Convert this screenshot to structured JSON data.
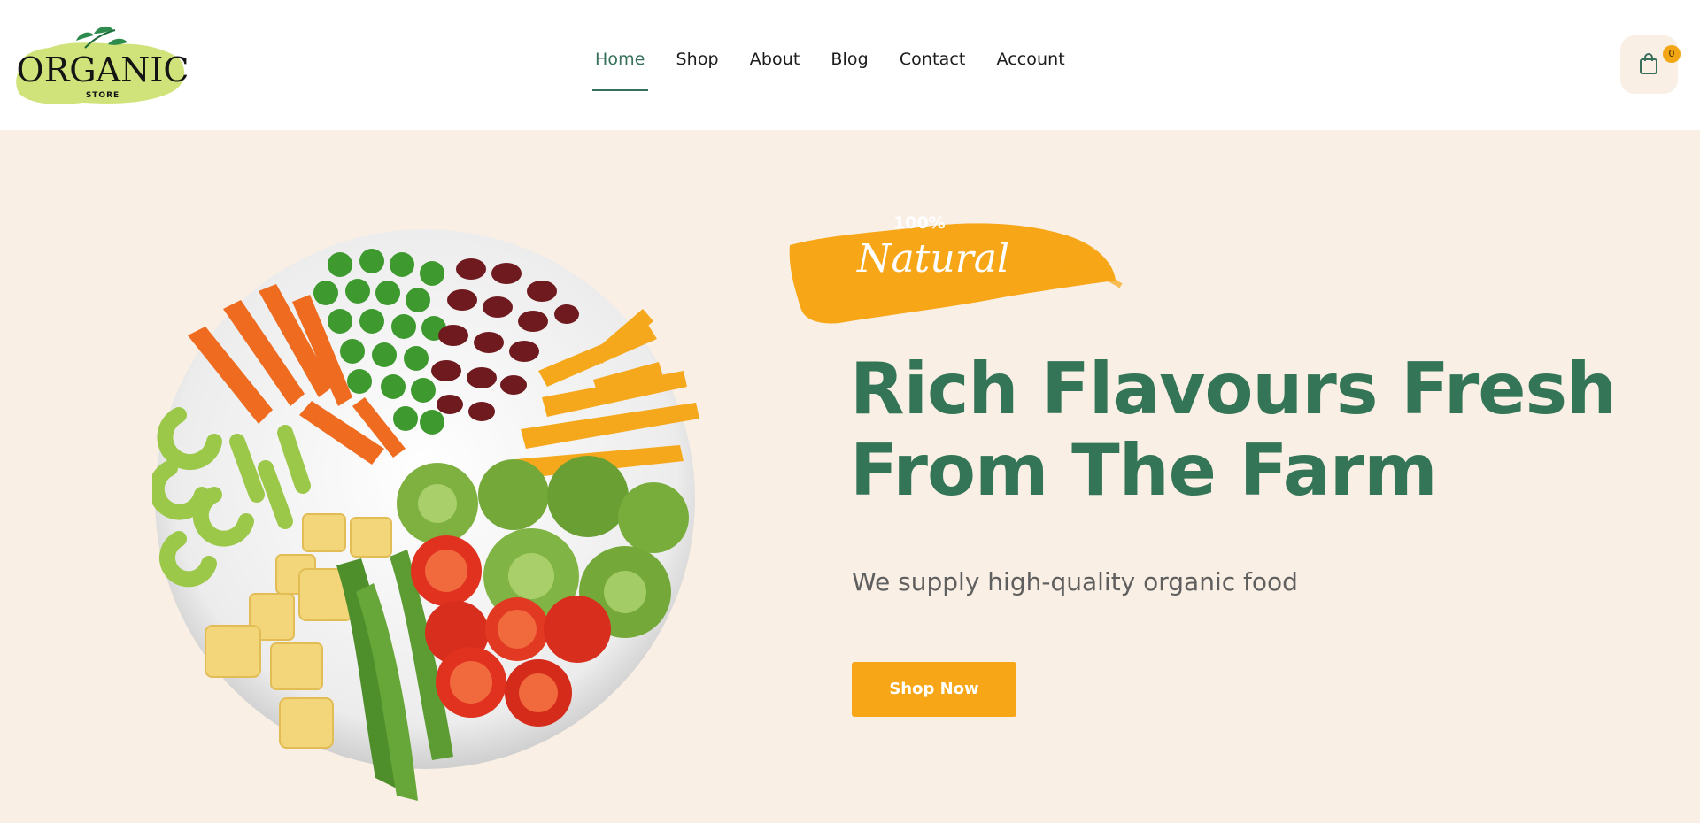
{
  "header": {
    "logo": {
      "word": "ORGANIC",
      "sub": "STORE"
    },
    "nav": [
      {
        "label": "Home",
        "active": true
      },
      {
        "label": "Shop",
        "active": false
      },
      {
        "label": "About",
        "active": false
      },
      {
        "label": "Blog",
        "active": false
      },
      {
        "label": "Contact",
        "active": false
      },
      {
        "label": "Account",
        "active": false
      }
    ],
    "cart": {
      "icon": "shopping-bag-icon",
      "count": "0"
    }
  },
  "hero": {
    "badge": {
      "top": "100%",
      "main": "Natural"
    },
    "title_line1": "Rich Flavours Fresh",
    "title_line2": "From The Farm",
    "subtitle": "We supply high-quality organic food",
    "cta_label": "Shop Now",
    "image": "vegetable-plate"
  },
  "colors": {
    "brand_green": "#347558",
    "accent_orange": "#f7a617",
    "hero_bg": "#f9efe4",
    "logo_lime": "#cfe37a"
  }
}
